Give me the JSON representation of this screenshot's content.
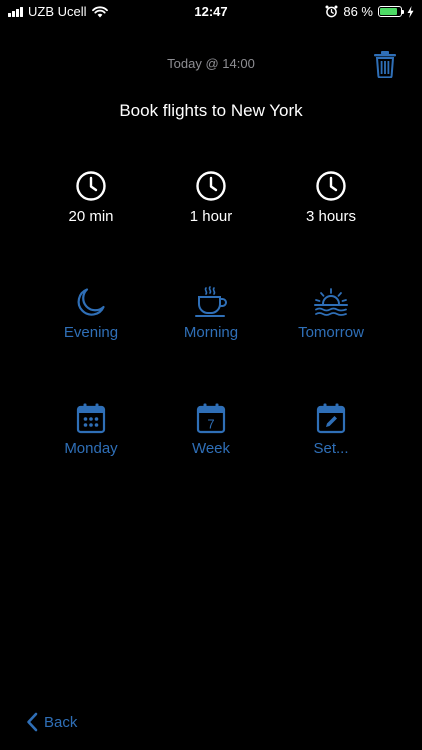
{
  "status_bar": {
    "carrier": "UZB Ucell",
    "time": "12:47",
    "battery_percent": "86 %",
    "battery_level": 0.86
  },
  "header": {
    "date": "Today @ 14:00",
    "title": "Book flights to New York"
  },
  "options": {
    "row1": [
      {
        "label": "20 min",
        "icon": "clock-icon"
      },
      {
        "label": "1 hour",
        "icon": "clock-icon"
      },
      {
        "label": "3 hours",
        "icon": "clock-icon"
      }
    ],
    "row2": [
      {
        "label": "Evening",
        "icon": "moon-icon"
      },
      {
        "label": "Morning",
        "icon": "coffee-cup-icon"
      },
      {
        "label": "Tomorrow",
        "icon": "sunrise-icon"
      }
    ],
    "row3": [
      {
        "label": "Monday",
        "icon": "calendar-icon"
      },
      {
        "label": "Week",
        "icon": "calendar-week-icon",
        "day": "7"
      },
      {
        "label": "Set...",
        "icon": "calendar-edit-icon"
      }
    ]
  },
  "footer": {
    "back_label": "Back"
  },
  "colors": {
    "background": "#000000",
    "accent_blue": "#2f6fb7",
    "muted_text": "#8e8e93",
    "battery_green": "#4cd964"
  }
}
